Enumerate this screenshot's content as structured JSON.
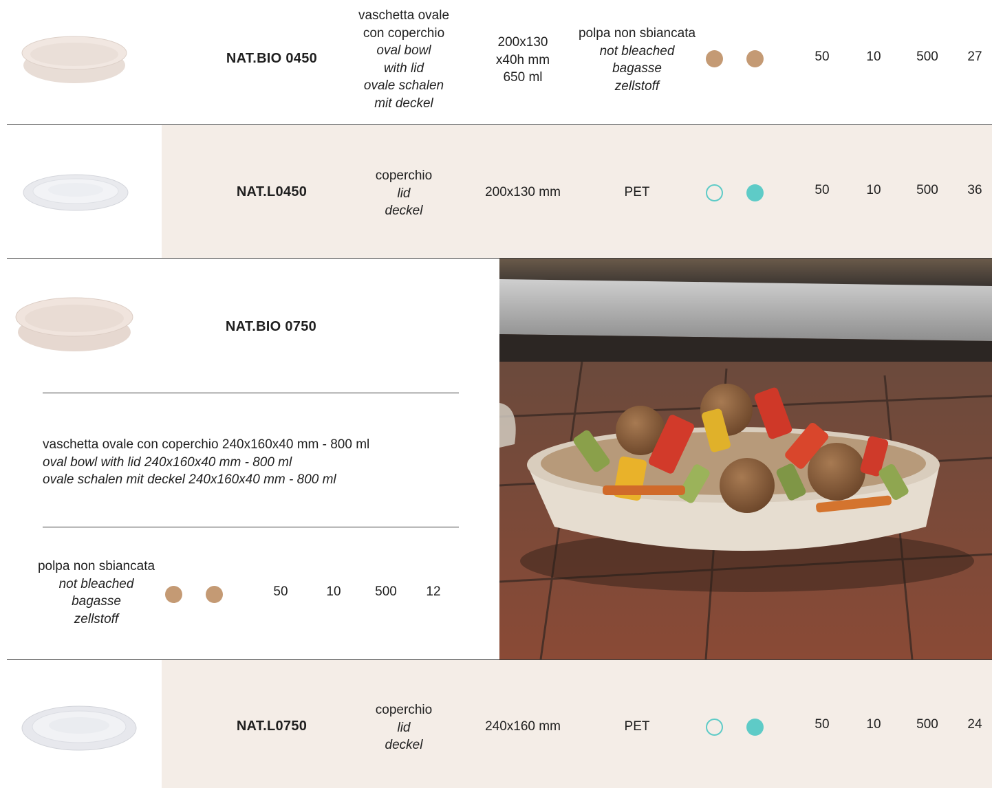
{
  "rows": [
    {
      "code": "NAT.BIO 0450",
      "description": [
        "vaschetta ovale",
        "con coperchio",
        "oval bowl",
        "with lid",
        "ovale schalen",
        "mit deckel"
      ],
      "size": [
        "200x130",
        "x40h mm",
        "650 ml"
      ],
      "material": [
        "polpa non sbiancata",
        "not bleached",
        "bagasse",
        "zellstoff"
      ],
      "icons": [
        "brown-dot-icon",
        "brown-dot-icon"
      ],
      "numbers": [
        "50",
        "10",
        "500",
        "27"
      ]
    },
    {
      "code": "NAT.L0450",
      "description": [
        "coperchio",
        "lid",
        "deckel"
      ],
      "size": [
        "200x130 mm"
      ],
      "material": [
        "PET"
      ],
      "icons": [
        "teal-ring-icon",
        "teal-dot-icon"
      ],
      "numbers": [
        "50",
        "10",
        "500",
        "36"
      ]
    },
    {
      "code": "NAT.BIO 0750",
      "description": [
        "vaschetta ovale con coperchio 240x160x40 mm - 800 ml",
        "oval bowl with lid 240x160x40 mm - 800 ml",
        "ovale schalen mit deckel 240x160x40 mm - 800 ml"
      ],
      "material": [
        "polpa non sbiancata",
        "not bleached",
        "bagasse",
        "zellstoff"
      ],
      "icons": [
        "brown-dot-icon",
        "brown-dot-icon"
      ],
      "numbers": [
        "50",
        "10",
        "500",
        "12"
      ]
    },
    {
      "code": "NAT.L0750",
      "description": [
        "coperchio",
        "lid",
        "deckel"
      ],
      "size": [
        "240x160 mm"
      ],
      "material": [
        "PET"
      ],
      "icons": [
        "teal-ring-icon",
        "teal-dot-icon"
      ],
      "numbers": [
        "50",
        "10",
        "500",
        "24"
      ]
    }
  ],
  "colors": {
    "band": "#f4ede7",
    "brown": "#c49a74",
    "teal": "#5ecbc7",
    "rule": "#3a3a3a"
  },
  "photo": {
    "subject": "food-photo"
  }
}
